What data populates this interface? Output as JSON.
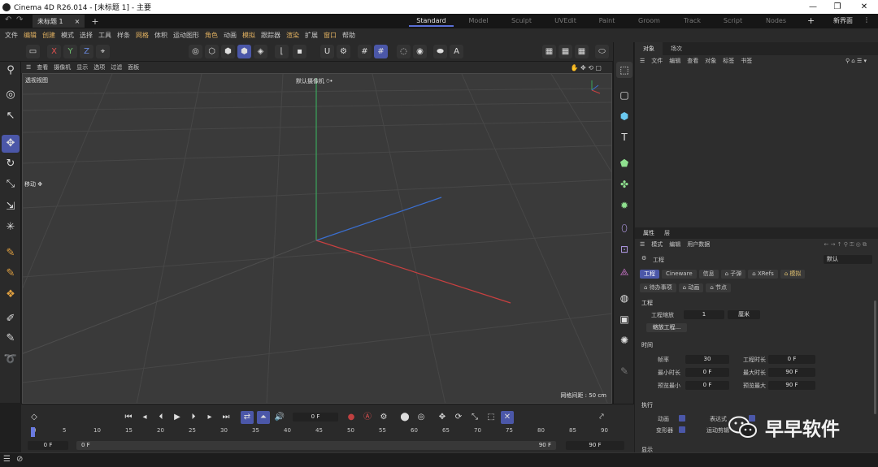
{
  "app": {
    "title": "Cinema 4D R26.014 - [未标题 1] - 主要"
  },
  "window_controls": {
    "minimize": "—",
    "maximize": "❐",
    "close": "✕"
  },
  "tabs": {
    "document": "未标题 1",
    "close": "×",
    "add": "+"
  },
  "layouts": {
    "items": [
      "Standard",
      "Model",
      "Sculpt",
      "UVEdit",
      "Paint",
      "Groom",
      "Track",
      "Script",
      "Nodes"
    ],
    "add": "+",
    "new_interface": "新界面"
  },
  "menu": {
    "items": [
      "文件",
      "编辑",
      "创建",
      "模式",
      "选择",
      "工具",
      "样条",
      "网格",
      "体积",
      "运动图形",
      "角色",
      "动画",
      "模拟",
      "跟踪器",
      "渲染",
      "扩展",
      "窗口",
      "帮助"
    ],
    "highlighted": [
      1,
      2,
      7,
      10,
      12,
      14,
      16
    ]
  },
  "toolbar": {
    "axes": [
      "X",
      "Y",
      "Z"
    ]
  },
  "viewport_menu": {
    "items": [
      "查看",
      "摄像机",
      "显示",
      "选项",
      "过滤",
      "面板"
    ]
  },
  "viewport": {
    "label": "透视视图",
    "camera": "默认摄像机 ⍥•",
    "grid_spacing": "网格间距 : 50 cm",
    "move_tip": "移动 ✥",
    "axis_colors": {
      "x": "#c84040",
      "y": "#3ba55c",
      "z": "#3a6fd0"
    }
  },
  "object_panel": {
    "tabs": [
      "对象",
      "场次"
    ],
    "menu": [
      "文件",
      "编辑",
      "查看",
      "对象",
      "标签",
      "书签"
    ]
  },
  "attribute_panel": {
    "tabs": [
      "属性",
      "层"
    ],
    "menu": [
      "模式",
      "编辑",
      "用户数据"
    ],
    "project_label": "工程",
    "preset": "默认",
    "pills_row1": [
      "工程",
      "Cineware",
      "信息",
      "⌂ 子弹",
      "⌂ XRefs",
      "⌂ 模拟"
    ],
    "pills_row2": [
      "⌂ 待办事项",
      "⌂ 动画",
      "⌂ 节点"
    ],
    "section_project": "工程",
    "scale_label": "工程缩放",
    "scale_value": "1",
    "scale_unit": "厘米",
    "scale_button": "缩放工程...",
    "section_time": "时间",
    "fps_label": "帧率",
    "fps_value": "30",
    "proj_len_label": "工程时长",
    "proj_len_value": "0 F",
    "min_time_label": "最小时长",
    "min_time_value": "0 F",
    "max_time_label": "最大时长",
    "max_time_value": "90 F",
    "prev_min_label": "预览最小",
    "prev_min_value": "0 F",
    "prev_max_label": "预览最大",
    "prev_max_value": "90 F",
    "section_exec": "执行",
    "exec_anim": "动画",
    "exec_expr": "表达式",
    "exec_deform": "变形器",
    "exec_motion": "运动剪辑",
    "section_display": "显示"
  },
  "timeline": {
    "ruler": [
      "0",
      "5",
      "10",
      "15",
      "20",
      "25",
      "30",
      "35",
      "40",
      "45",
      "50",
      "55",
      "60",
      "65",
      "70",
      "75",
      "80",
      "85",
      "90"
    ],
    "current_frame": "0 F",
    "start": "0 F",
    "range_start": "0 F",
    "range_end": "90 F",
    "end": "90 F"
  },
  "watermark": {
    "text": "早早软件"
  }
}
